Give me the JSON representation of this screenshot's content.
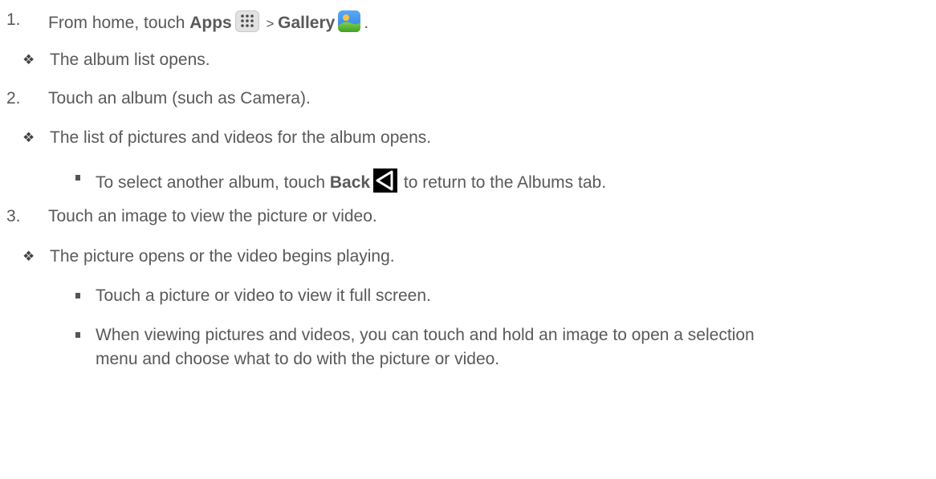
{
  "steps": [
    {
      "number": "1.",
      "parts": {
        "pre": "From home, touch ",
        "apps": "Apps",
        "sep": " > ",
        "gallery": "Gallery",
        "post": "."
      },
      "results": [
        {
          "text": "The album list opens."
        }
      ]
    },
    {
      "number": "2.",
      "text": "Touch an album (such as Camera).",
      "results": [
        {
          "text": "The list of pictures and videos for the album opens."
        }
      ],
      "notes": [
        {
          "pre": "To select another album, touch ",
          "back": "Back",
          "post": " to return to the Albums tab."
        }
      ]
    },
    {
      "number": "3.",
      "text": "Touch an image to view the picture or video.",
      "results": [
        {
          "text": "The picture opens or the video begins playing."
        }
      ],
      "notes": [
        {
          "text": "Touch a picture or video to view it full screen."
        },
        {
          "line1": "When viewing pictures and videos, you can touch and hold an image to open a selection",
          "line2": "menu and choose what to do with the picture or video."
        }
      ]
    }
  ],
  "icons": {
    "apps": "apps-grid-icon",
    "gallery": "gallery-icon",
    "back": "back-triangle-icon",
    "result_bullet": "diamond-bullet-icon",
    "note_bullet": "square-bullet-icon"
  }
}
